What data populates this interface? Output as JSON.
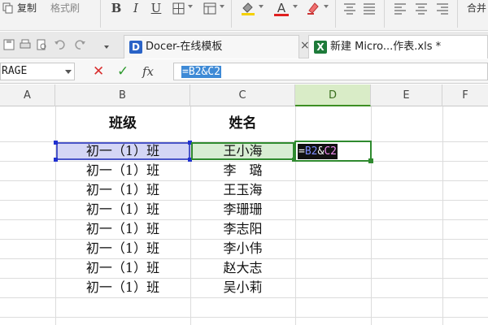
{
  "ribbon": {
    "copy_label": "复制",
    "format_painter_label": "格式刷",
    "bold_glyph": "B",
    "italic_glyph": "I",
    "underline_glyph": "U",
    "font_color_glyph": "A",
    "merge_label": "合并"
  },
  "tabs": [
    {
      "label": "Docer-在线模板",
      "icon": "docer-logo-icon"
    },
    {
      "label": "新建 Micro...作表.xls *",
      "icon": "excel-logo-icon"
    }
  ],
  "formula_bar": {
    "name_box": "RAGE",
    "cancel_glyph": "✕",
    "confirm_glyph": "✓",
    "fx_label": "fx",
    "formula": "=B2&C2"
  },
  "columns": [
    "A",
    "B",
    "C",
    "D",
    "E",
    "F"
  ],
  "active_column": "D",
  "sheet": {
    "headers": {
      "class": "班级",
      "name": "姓名"
    },
    "rows": [
      {
        "class": "初一（1）班",
        "name": "王小海"
      },
      {
        "class": "初一（1）班",
        "name": "李　璐"
      },
      {
        "class": "初一（1）班",
        "name": "王玉海"
      },
      {
        "class": "初一（1）班",
        "name": "李珊珊"
      },
      {
        "class": "初一（1）班",
        "name": "李志阳"
      },
      {
        "class": "初一（1）班",
        "name": "李小伟"
      },
      {
        "class": "初一（1）班",
        "name": "赵大志"
      },
      {
        "class": "初一（1）班",
        "name": "吴小莉"
      }
    ],
    "editing_cell": {
      "ref": "D2",
      "parts": [
        "=",
        "B2",
        "&",
        "C2"
      ]
    }
  },
  "colors": {
    "ref_b2": "#4a55c8",
    "ref_c2": "#2f8a2f",
    "active_border": "#2f8a2f",
    "formula_highlight": "#3e8ad6"
  }
}
